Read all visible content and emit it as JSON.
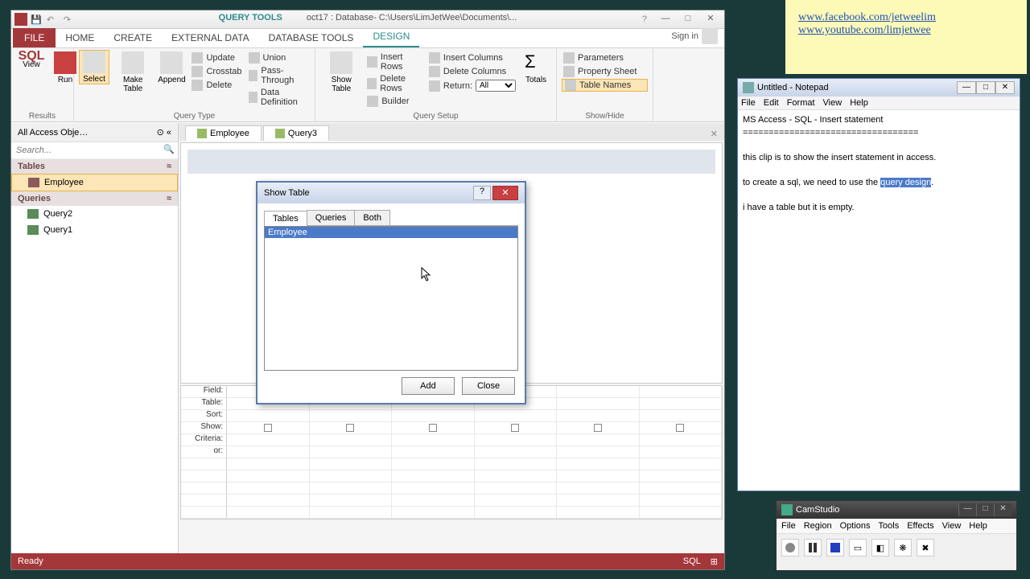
{
  "access": {
    "title_tool": "QUERY TOOLS",
    "title_file": "oct17 : Database- C:\\Users\\LimJetWee\\Documents\\...",
    "tabs": {
      "file": "FILE",
      "home": "HOME",
      "create": "CREATE",
      "external": "EXTERNAL DATA",
      "dbtools": "DATABASE TOOLS",
      "design": "DESIGN"
    },
    "signin": "Sign in",
    "ribbon": {
      "results": {
        "label": "Results",
        "view": "View",
        "run": "Run",
        "sql": "SQL"
      },
      "querytype": {
        "label": "Query Type",
        "select": "Select",
        "make": "Make\nTable",
        "append": "Append",
        "update": "Update",
        "crosstab": "Crosstab",
        "delete": "Delete",
        "union": "Union",
        "passthrough": "Pass-Through",
        "datadef": "Data Definition"
      },
      "querysetup": {
        "label": "Query Setup",
        "showtable": "Show\nTable",
        "insrows": "Insert Rows",
        "delrows": "Delete Rows",
        "builder": "Builder",
        "inscols": "Insert Columns",
        "delcols": "Delete Columns",
        "return": "Return:",
        "returnval": "All",
        "totals": "Totals"
      },
      "showhide": {
        "label": "Show/Hide",
        "params": "Parameters",
        "propsheet": "Property Sheet",
        "tablenames": "Table Names"
      }
    },
    "nav": {
      "header": "All Access Obje…",
      "search": "Search...",
      "tables": "Tables",
      "queries": "Queries",
      "items": {
        "employee": "Employee",
        "query2": "Query2",
        "query1": "Query1"
      }
    },
    "doctabs": {
      "employee": "Employee",
      "query3": "Query3"
    },
    "grid": {
      "field": "Field:",
      "table": "Table:",
      "sort": "Sort:",
      "show": "Show:",
      "criteria": "Criteria:",
      "or": "or:"
    },
    "status": {
      "ready": "Ready",
      "sql": "SQL"
    }
  },
  "dialog": {
    "title": "Show Table",
    "tabs": {
      "tables": "Tables",
      "queries": "Queries",
      "both": "Both"
    },
    "item": "Employee",
    "add": "Add",
    "close": "Close"
  },
  "sticky": {
    "link1": "www.facebook.com/jetweelim",
    "link2": "www.youtube.com/limjetwee"
  },
  "notepad": {
    "title": "Untitled - Notepad",
    "menu": {
      "file": "File",
      "edit": "Edit",
      "format": "Format",
      "view": "View",
      "help": "Help"
    },
    "line1": "MS Access - SQL - Insert statement",
    "line2": "==================================",
    "line3": "this clip is to show the insert statement in access.",
    "line4a": "to create a sql, we need to use the ",
    "line4hl": "query design",
    "line4b": ".",
    "line5": "i have a table but it is empty."
  },
  "camstudio": {
    "title": "CamStudio",
    "menu": {
      "file": "File",
      "region": "Region",
      "options": "Options",
      "tools": "Tools",
      "effects": "Effects",
      "view": "View",
      "help": "Help"
    }
  }
}
